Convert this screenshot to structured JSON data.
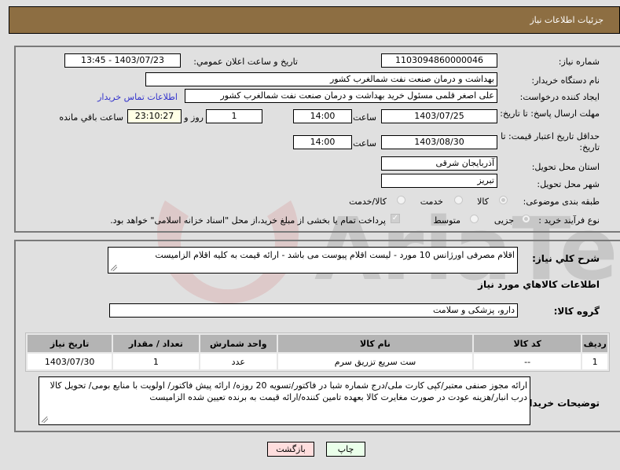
{
  "header": {
    "title": "جزئیات اطلاعات نیاز"
  },
  "form": {
    "need_number": {
      "label": "شماره نیاز:",
      "value": "1103094860000046"
    },
    "announce_datetime": {
      "label": "تاریخ و ساعت اعلان عمومي:",
      "value": "1403/07/23 - 13:45"
    },
    "buyer_org": {
      "label": "نام دستگاه خریدار:",
      "value": "بهداشت و درمان صنعت نفت شمالغرب کشور"
    },
    "requester": {
      "label": "ایجاد کننده درخواست:",
      "value": "علی اصغر قلمی مسئول خرید بهداشت و درمان صنعت نفت شمالغرب کشور"
    },
    "buyer_contact_link": "اطلاعات تماس خریدار",
    "response_deadline": {
      "label": "مهلت ارسال پاسخ: تا تاریخ:",
      "date": "1403/07/25",
      "time_label": "ساعت",
      "time": "14:00",
      "days": "1",
      "days_label": "روز و",
      "remaining": "23:10:27",
      "remaining_label": "ساعت باقي مانده"
    },
    "price_validity": {
      "label": "حداقل تاریخ اعتبار قیمت: تا تاریخ:",
      "date": "1403/08/30",
      "time_label": "ساعت",
      "time": "14:00"
    },
    "delivery_province": {
      "label": "استان محل تحویل:",
      "value": "آذربایجان شرقی"
    },
    "delivery_city": {
      "label": "شهر محل تحویل:",
      "value": "تبریز"
    },
    "category": {
      "label": "طبقه بندی موضوعی:",
      "options": [
        "کالا",
        "خدمت",
        "کالا/خدمت"
      ],
      "selected": "کالا"
    },
    "purchase_process": {
      "label": "نوع فرآیند خرید :",
      "options": [
        "جزیی",
        "متوسط"
      ],
      "selected": "جزیی",
      "treasury_checkbox_label": "پرداخت تمام یا بخشی از مبلغ خرید،از محل \"اسناد خزانه اسلامی\" خواهد بود.",
      "treasury_checked": true
    }
  },
  "description": {
    "label": "شرح کلي نياز:",
    "value": "اقلام مصرفی اورژانس 10 مورد - لیست اقلام پیوست می باشد - ارائه قیمت به کلیه اقلام الزامیست"
  },
  "goods": {
    "section_title": "اطلاعات کالاهاي مورد نياز",
    "group_label": "گروه کالا:",
    "group_value": "دارو، پزشکی و سلامت",
    "columns": [
      "ردیف",
      "کد کالا",
      "نام کالا",
      "واحد شمارش",
      "تعداد / مقدار",
      "تاریخ نیاز"
    ],
    "rows": [
      [
        "1",
        "--",
        "ست سریع تزریق سرم",
        "عدد",
        "1",
        "1403/07/30"
      ]
    ]
  },
  "buyer_notes": {
    "label": "توضیحات خریدار:",
    "value": "ارائه مجوز صنفی معتبر/کپی کارت ملی/درج شماره شبا در فاکتور/تسویه 20 روزه/ ارائه پیش فاکتور/ اولویت با منابع بومی/ تحویل کالا درب انبار/هزینه عودت در صورت مغایرت کالا بعهده تامین کننده/ارائه قیمت به برنده تعیین شده الزامیست"
  },
  "buttons": {
    "print": "چاپ",
    "back": "بازگشت"
  },
  "watermark": "AriaTender.net",
  "colors": {
    "header_bg": "#8d6e42",
    "link": "#3333cc",
    "print_bg": "#eaffea",
    "back_bg": "#ffdede"
  }
}
